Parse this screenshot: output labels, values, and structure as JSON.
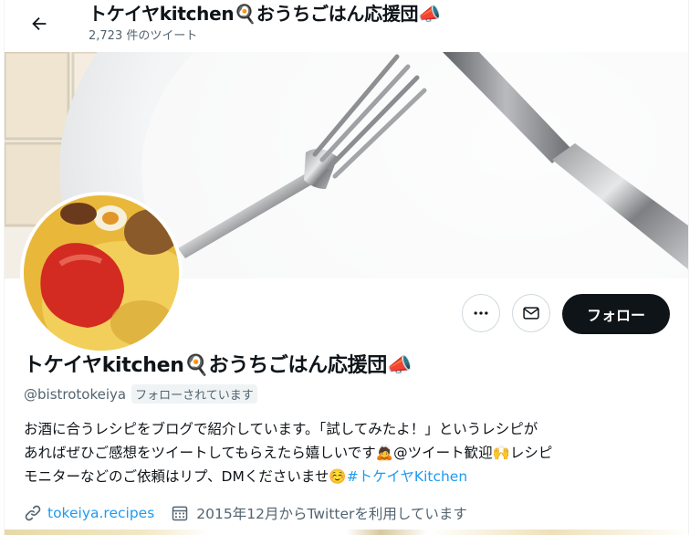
{
  "header": {
    "title": "トケイヤkitchen🍳おうちごはん応援団📣",
    "tweet_count": "2,723 件のツイート"
  },
  "profile": {
    "name": "トケイヤkitchen🍳おうちごはん応援団📣",
    "handle": "@bistrotokeiya",
    "follows_you": "フォローされています",
    "bio_line1": "お酒に合うレシピをブログで紹介しています。「試してみたよ！」というレシピが",
    "bio_line2": "あればぜひご感想をツイートしてもらえたら嬉しいです🙇@ツイート歓迎🙌レシピ",
    "bio_line3_text": "モニターなどのご依頼はリプ、DMくださいませ☺️",
    "bio_hashtag": "#トケイヤKitchen",
    "website": "tokeiya.recipes",
    "joined": "2015年12月からTwitterを利用しています"
  },
  "actions": {
    "follow_label": "フォロー"
  },
  "icons": {
    "back": "arrow-left-icon",
    "more": "more-dots-icon",
    "message": "envelope-icon",
    "link": "link-icon",
    "calendar": "calendar-icon"
  },
  "colors": {
    "accent": "#1d9bf0",
    "text": "#0f1419",
    "muted": "#536471",
    "follow_bg": "#0f1419"
  }
}
